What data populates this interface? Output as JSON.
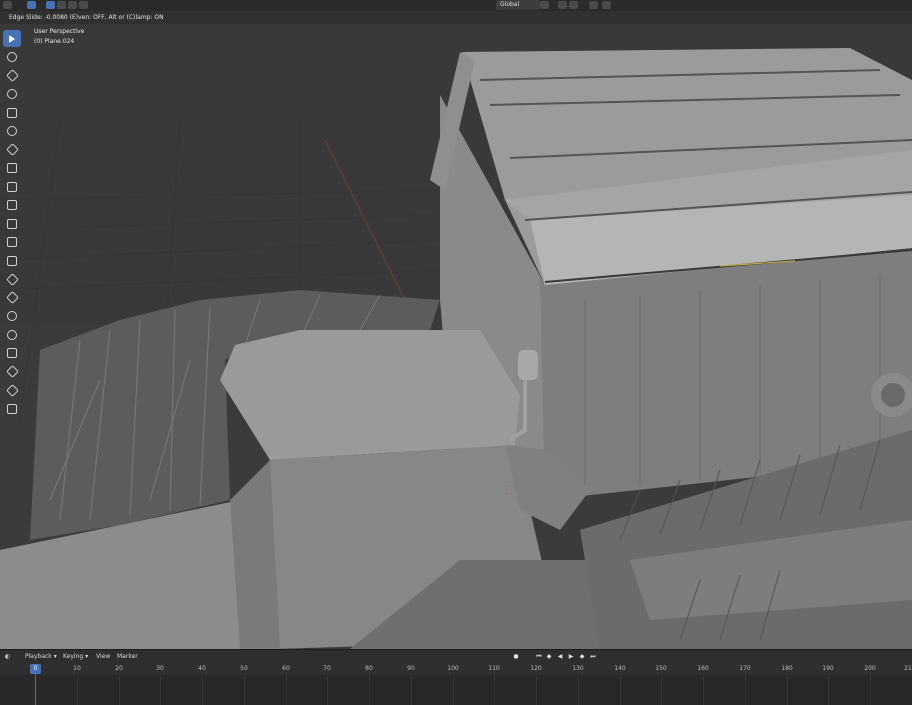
{
  "header": {
    "orientation": "Global",
    "icons": [
      "editor-type-icon",
      "select-tool-icon",
      "select-mode-icons",
      "transform-pivot-icon",
      "snap-icon",
      "proportional-edit-icon"
    ]
  },
  "status": {
    "text": "Edge Slide: -0.0080 (E)ven: OFF, Alt or (C)lamp: ON"
  },
  "viewport": {
    "view_name": "User Perspective",
    "object_name": "(0) Plane.024"
  },
  "toolbar": {
    "tools": [
      "select-box",
      "cursor",
      "move",
      "rotate",
      "scale",
      "transform",
      "annotate",
      "measure",
      "add-cube",
      "extrude-region",
      "inset-faces",
      "bevel",
      "loop-cut",
      "knife",
      "poly-build",
      "spin",
      "smooth",
      "edge-slide",
      "shrink-fatten",
      "shear",
      "rip-region"
    ]
  },
  "timeline": {
    "menus": [
      "Playback",
      "Keying",
      "View",
      "Marker"
    ],
    "current_frame": "0",
    "ticks": [
      "0",
      "10",
      "20",
      "30",
      "40",
      "50",
      "60",
      "70",
      "80",
      "90",
      "100",
      "110",
      "120",
      "130",
      "140",
      "150",
      "160",
      "170",
      "180",
      "190",
      "200",
      "21"
    ],
    "colors": {
      "accent": "#4772b3",
      "background": "#282828"
    }
  }
}
